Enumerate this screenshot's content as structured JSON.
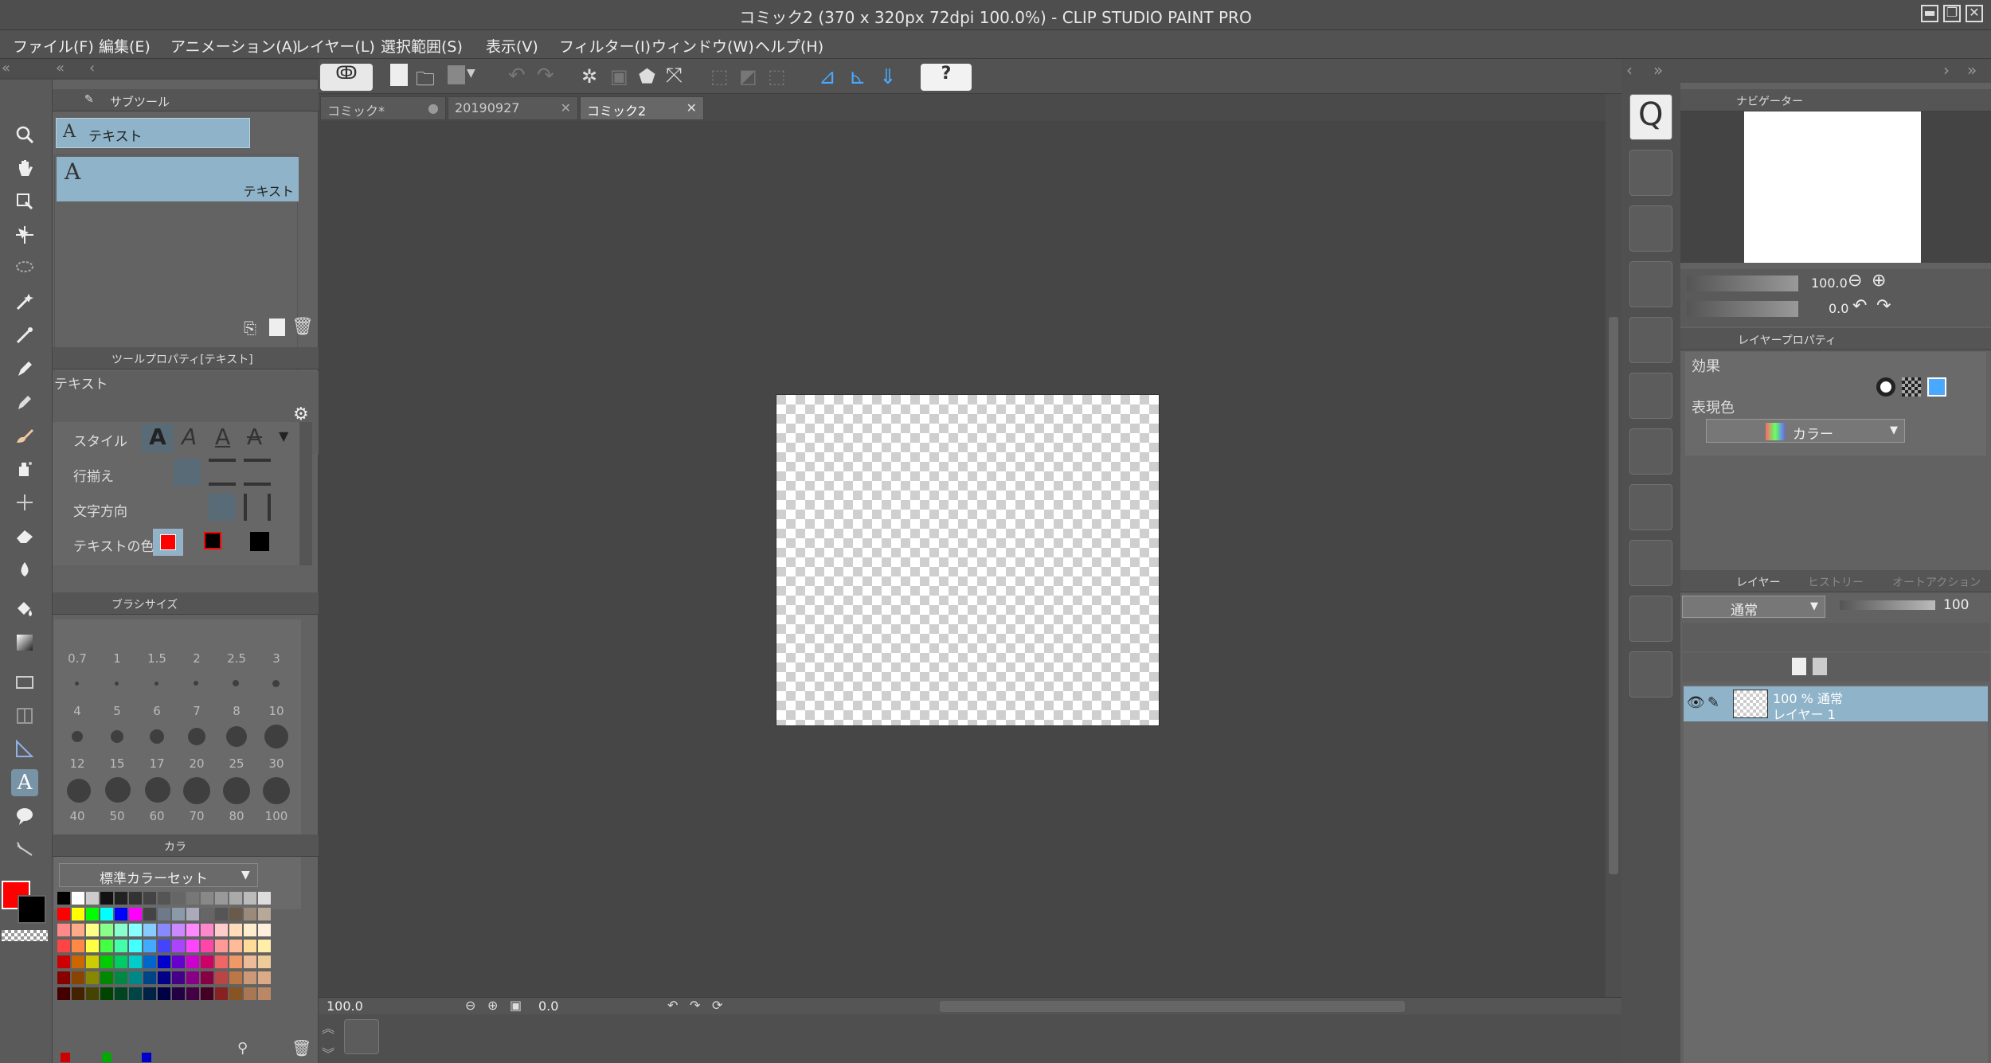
{
  "window": {
    "title": "コミック2 (370 x 320px 72dpi 100.0%)  - CLIP STUDIO PAINT PRO",
    "minimize": "▬",
    "restore": "❐",
    "close": "✕"
  },
  "menu": [
    "ファイル(F)",
    "編集(E)",
    "アニメーション(A)",
    "レイヤー(L)",
    "選択範囲(S)",
    "表示(V)",
    "フィルター(I)",
    "ウィンドウ(W)",
    "ヘルプ(H)"
  ],
  "tabs": [
    {
      "label": "コミック*",
      "close": "●"
    },
    {
      "label": "20190927",
      "close": "✕"
    },
    {
      "label": "コミック2",
      "close": "✕"
    }
  ],
  "subtool": {
    "title": "サブツール",
    "selected_group": "テキスト",
    "item_label": "テキスト",
    "item_glyph": "A"
  },
  "tool_property": {
    "title": "ツールプロパティ[テキスト]",
    "tool_name": "テキスト",
    "rows": [
      {
        "label": "スタイル"
      },
      {
        "label": "行揃え"
      },
      {
        "label": "文字方向"
      },
      {
        "label": "テキストの色"
      }
    ]
  },
  "brush_size": {
    "title": "ブラシサイズ",
    "sizes": [
      "0.7",
      "1",
      "1.5",
      "2",
      "2.5",
      "3",
      "4",
      "5",
      "6",
      "7",
      "8",
      "10",
      "12",
      "15",
      "17",
      "20",
      "25",
      "30",
      "40",
      "50",
      "60",
      "70",
      "80",
      "100"
    ]
  },
  "color_set": {
    "tab_label": "カラ",
    "set_name": "標準カラーセット"
  },
  "colors": {
    "main": "#ff0000",
    "sub": "#000000",
    "accent": "#8fb3c8"
  },
  "navigator": {
    "title": "ナビゲーター",
    "zoom": "100.0",
    "angle": "0.0"
  },
  "layer_property": {
    "title": "レイヤープロパティ",
    "effect_label": "効果",
    "expression_label": "表現色",
    "expression_value": "カラー"
  },
  "layer_panel": {
    "tabs": [
      "レイヤー",
      "ヒストリー",
      "オートアクション"
    ],
    "blend_mode": "通常",
    "opacity": "100",
    "layers": [
      {
        "info": "100 % 通常",
        "name": "レイヤー 1"
      }
    ]
  },
  "canvas_status": {
    "zoom": "100.0",
    "angle": "0.0"
  }
}
